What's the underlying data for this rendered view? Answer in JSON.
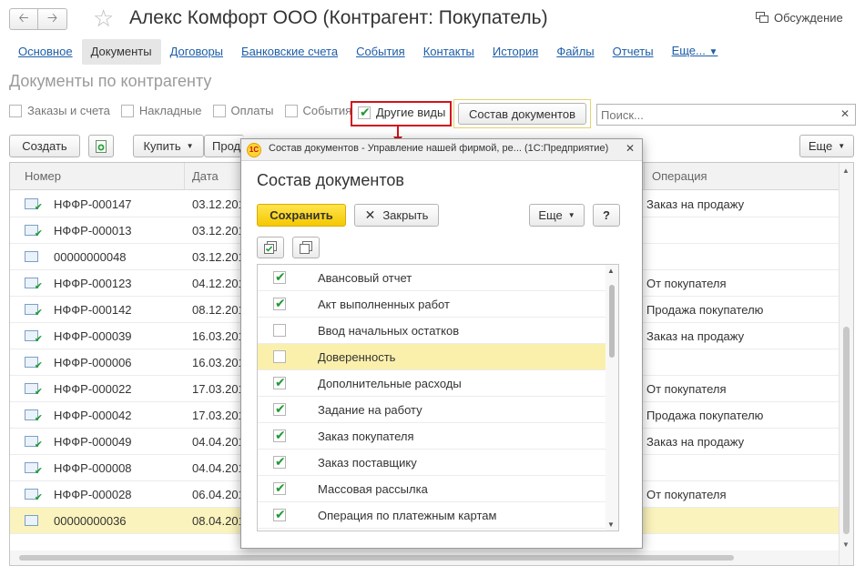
{
  "header": {
    "title": "Алекс Комфорт ООО (Контрагент: Покупатель)",
    "discussion": "Обсуждение",
    "back_icon": "arrow-left-icon",
    "forward_icon": "arrow-right-icon"
  },
  "tabs": [
    {
      "label": "Основное"
    },
    {
      "label": "Документы"
    },
    {
      "label": "Договоры"
    },
    {
      "label": "Банковские счета"
    },
    {
      "label": "События"
    },
    {
      "label": "Контакты"
    },
    {
      "label": "История"
    },
    {
      "label": "Файлы"
    },
    {
      "label": "Отчеты"
    },
    {
      "label": "Еще..."
    }
  ],
  "subtitle": "Документы по контрагенту",
  "filters": {
    "orders": "Заказы и счета",
    "invoices": "Накладные",
    "payments": "Оплаты",
    "events": "События",
    "other": "Другие виды",
    "composition_button": "Состав документов",
    "search_placeholder": "Поиск..."
  },
  "toolbar": {
    "create": "Создать",
    "buy": "Купить",
    "sell_partial": "Прод",
    "more": "Еще"
  },
  "table": {
    "columns": {
      "number": "Номер",
      "date": "Дата",
      "operation": "Операция"
    },
    "rows": [
      {
        "number": "НФФР-000147",
        "date": "03.12.201",
        "operation": "Заказ на продажу"
      },
      {
        "number": "НФФР-000013",
        "date": "03.12.201",
        "operation": ""
      },
      {
        "number": "00000000048",
        "date": "03.12.201",
        "operation": ""
      },
      {
        "number": "НФФР-000123",
        "date": "04.12.201",
        "operation": "От покупателя"
      },
      {
        "number": "НФФР-000142",
        "date": "08.12.201",
        "operation": "Продажа покупателю"
      },
      {
        "number": "НФФР-000039",
        "date": "16.03.201",
        "operation": "Заказ на продажу"
      },
      {
        "number": "НФФР-000006",
        "date": "16.03.201",
        "operation": ""
      },
      {
        "number": "НФФР-000022",
        "date": "17.03.201",
        "operation": "От покупателя"
      },
      {
        "number": "НФФР-000042",
        "date": "17.03.201",
        "operation": "Продажа покупателю"
      },
      {
        "number": "НФФР-000049",
        "date": "04.04.201",
        "operation": "Заказ на продажу"
      },
      {
        "number": "НФФР-000008",
        "date": "04.04.201",
        "operation": ""
      },
      {
        "number": "НФФР-000028",
        "date": "06.04.201",
        "operation": "От покупателя"
      },
      {
        "number": "00000000036",
        "date": "08.04.201",
        "operation": ""
      }
    ]
  },
  "modal": {
    "window_title": "Состав документов - Управление нашей фирмой, ре...  (1С:Предприятие)",
    "logo_text": "1С",
    "heading": "Состав документов",
    "save": "Сохранить",
    "close": "Закрыть",
    "more": "Еще",
    "help": "?",
    "items": [
      {
        "label": "Авансовый отчет",
        "checked": true
      },
      {
        "label": "Акт выполненных работ",
        "checked": true
      },
      {
        "label": "Ввод начальных остатков",
        "checked": false
      },
      {
        "label": "Доверенность",
        "checked": false
      },
      {
        "label": "Дополнительные расходы",
        "checked": true
      },
      {
        "label": "Задание на работу",
        "checked": true
      },
      {
        "label": "Заказ покупателя",
        "checked": true
      },
      {
        "label": "Заказ поставщику",
        "checked": true
      },
      {
        "label": "Массовая рассылка",
        "checked": true
      },
      {
        "label": "Операция по платежным картам",
        "checked": true
      }
    ]
  },
  "colors": {
    "accent_yellow": "#f5c800",
    "highlight_red": "#d0141b",
    "link_blue": "#1d5ea8",
    "check_green": "#1e9a34",
    "selection": "#fbf3bd"
  }
}
